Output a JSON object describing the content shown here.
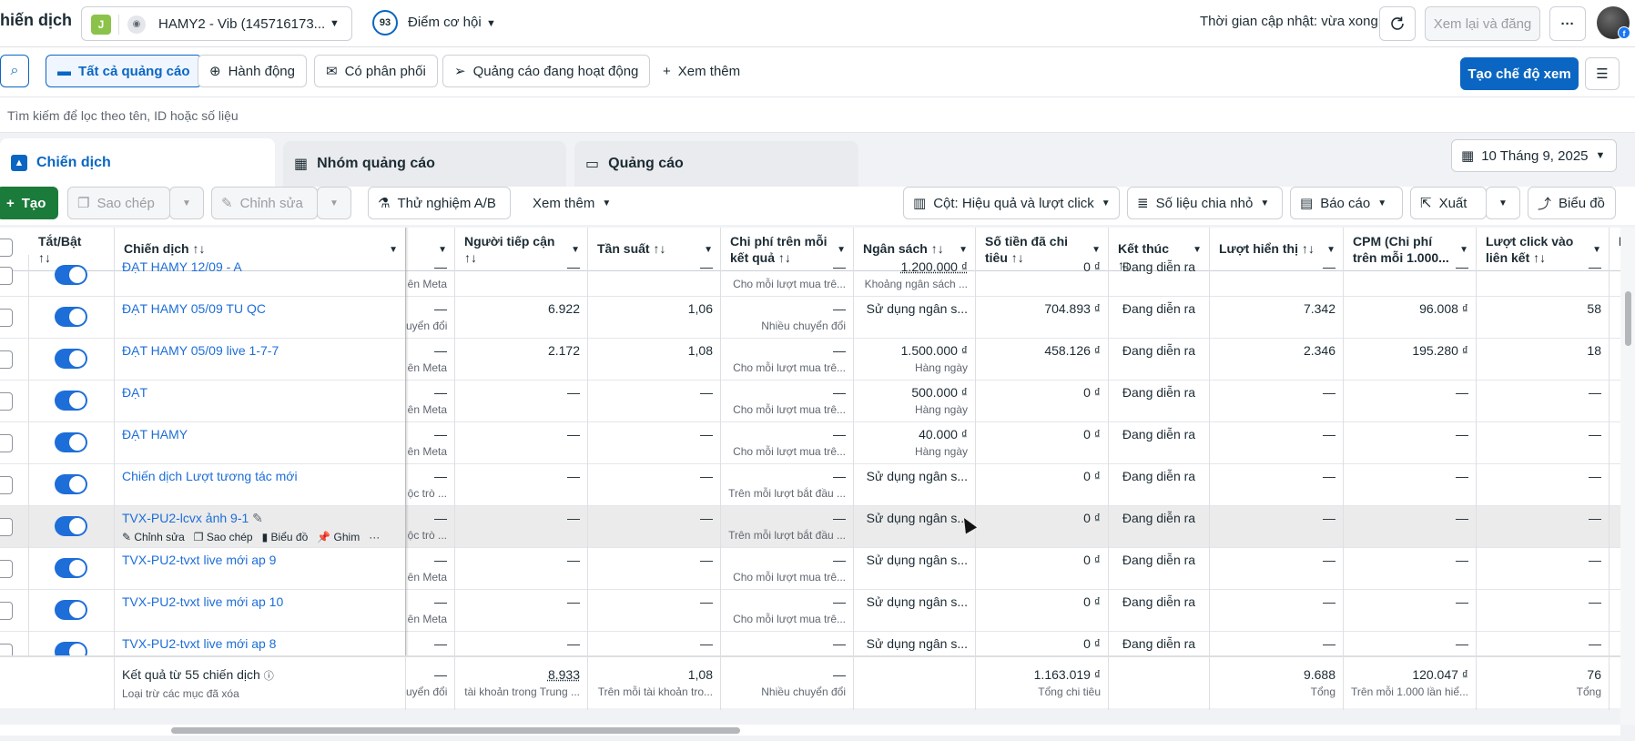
{
  "header": {
    "app_title": "hiến dịch",
    "account_badge": "J",
    "account_name": "HAMY2 - Vib (145716173...",
    "opportunity_score": "93",
    "opportunity_label": "Điểm cơ hội",
    "updated_text": "Thời gian cập nhật: vừa xong",
    "review_publish": "Xem lại và đăng",
    "more": "···"
  },
  "filters": {
    "all_ads": "Tất cả quảng cáo",
    "actions": "Hành động",
    "delivery": "Có phân phối",
    "active_ads": "Quảng cáo đang hoạt động",
    "see_more": "Xem thêm",
    "create_view": "Tạo chế độ xem",
    "search_placeholder": "Tìm kiếm để lọc theo tên, ID hoặc số liệu"
  },
  "tabs": {
    "campaigns": "Chiến dịch",
    "ad_sets": "Nhóm quảng cáo",
    "ads": "Quảng cáo",
    "date": "10 Tháng 9, 2025"
  },
  "toolbar": {
    "create": "Tạo",
    "duplicate": "Sao chép",
    "edit": "Chỉnh sửa",
    "ab_test": "Thử nghiệm A/B",
    "more": "Xem thêm",
    "columns": "Cột: Hiệu quả và lượt click",
    "breakdown": "Số liệu chia nhỏ",
    "reports": "Báo cáo",
    "export": "Xuất",
    "charts": "Biểu đồ"
  },
  "columns": {
    "toggle": "Tắt/Bật ↑↓",
    "campaign": "Chiến dịch ↑↓",
    "reach": "Người tiếp cận ↑↓",
    "frequency": "Tần suất ↑↓",
    "cost_per_result": "Chi phí trên mỗi kết quả ↑↓",
    "budget": "Ngân sách ↑↓",
    "amount_spent": "Số tiền đã chi tiêu ↑↓",
    "ends": "Kết thúc ↑↓",
    "impressions": "Lượt hiển thị ↑↓",
    "cpm": "CPM (Chi phí trên mỗi 1.000...",
    "link_clicks": "Lượt click vào liên kết ↑↓",
    "last": "L v"
  },
  "rows": [
    {
      "name": "ĐẠT HAMY 12/09 - A",
      "res_sub": "ên Meta",
      "reach": "—",
      "freq": "—",
      "cpr": "—",
      "cpr_sub": "Cho mỗi lượt mua trê...",
      "budget": "1.200.000 ₫",
      "budget_sub": "Khoảng ngân sách ...",
      "spent": "0 ₫",
      "ends": "Đang diễn ra",
      "impr": "—",
      "cpm": "—",
      "clicks": "—"
    },
    {
      "name": "ĐẠT HAMY 05/09 TU QC",
      "res_sub": "uyển đổi",
      "reach": "6.922",
      "freq": "1,06",
      "cpr": "—",
      "cpr_sub": "Nhiều chuyển đổi",
      "budget": "Sử dụng ngân s...",
      "budget_sub": "",
      "spent": "704.893 ₫",
      "ends": "Đang diễn ra",
      "impr": "7.342",
      "cpm": "96.008 ₫",
      "clicks": "58"
    },
    {
      "name": "ĐẠT HAMY 05/09 live 1-7-7",
      "res_sub": "ên Meta",
      "reach": "2.172",
      "freq": "1,08",
      "cpr": "—",
      "cpr_sub": "Cho mỗi lượt mua trê...",
      "budget": "1.500.000 ₫",
      "budget_sub": "Hàng ngày",
      "spent": "458.126 ₫",
      "ends": "Đang diễn ra",
      "impr": "2.346",
      "cpm": "195.280 ₫",
      "clicks": "18"
    },
    {
      "name": "ĐẠT",
      "res_sub": "ên Meta",
      "reach": "—",
      "freq": "—",
      "cpr": "—",
      "cpr_sub": "Cho mỗi lượt mua trê...",
      "budget": "500.000 ₫",
      "budget_sub": "Hàng ngày",
      "spent": "0 ₫",
      "ends": "Đang diễn ra",
      "impr": "—",
      "cpm": "—",
      "clicks": "—"
    },
    {
      "name": "ĐẠT HAMY",
      "res_sub": "ên Meta",
      "reach": "—",
      "freq": "—",
      "cpr": "—",
      "cpr_sub": "Cho mỗi lượt mua trê...",
      "budget": "40.000 ₫",
      "budget_sub": "Hàng ngày",
      "spent": "0 ₫",
      "ends": "Đang diễn ra",
      "impr": "—",
      "cpm": "—",
      "clicks": "—"
    },
    {
      "name": "Chiến dịch Lượt tương tác mới",
      "res_sub": "ộc trò ...",
      "reach": "—",
      "freq": "—",
      "cpr": "—",
      "cpr_sub": "Trên mỗi lượt bắt đầu ...",
      "budget": "Sử dụng ngân s...",
      "budget_sub": "",
      "spent": "0 ₫",
      "ends": "Đang diễn ra",
      "impr": "—",
      "cpm": "—",
      "clicks": "—"
    },
    {
      "name": "TVX-PU2-lcvx ảnh 9-1",
      "res_sub": "ộc trò ...",
      "reach": "—",
      "freq": "—",
      "cpr": "—",
      "cpr_sub": "Trên mỗi lượt bắt đầu ...",
      "budget": "Sử dụng ngân s...",
      "budget_sub": "",
      "spent": "0 ₫",
      "ends": "Đang diễn ra",
      "impr": "—",
      "cpm": "—",
      "clicks": "—"
    },
    {
      "name": "TVX-PU2-tvxt live mới ap 9",
      "res_sub": "ên Meta",
      "reach": "—",
      "freq": "—",
      "cpr": "—",
      "cpr_sub": "Cho mỗi lượt mua trê...",
      "budget": "Sử dụng ngân s...",
      "budget_sub": "",
      "spent": "0 ₫",
      "ends": "Đang diễn ra",
      "impr": "—",
      "cpm": "—",
      "clicks": "—"
    },
    {
      "name": "TVX-PU2-tvxt live mới ap 10",
      "res_sub": "ên Meta",
      "reach": "—",
      "freq": "—",
      "cpr": "—",
      "cpr_sub": "Cho mỗi lượt mua trê...",
      "budget": "Sử dụng ngân s...",
      "budget_sub": "",
      "spent": "0 ₫",
      "ends": "Đang diễn ra",
      "impr": "—",
      "cpm": "—",
      "clicks": "—"
    },
    {
      "name": "TVX-PU2-tvxt live mới ap 8",
      "res_sub": "",
      "reach": "—",
      "freq": "—",
      "cpr": "—",
      "cpr_sub": "",
      "budget": "Sử dụng ngân s...",
      "budget_sub": "",
      "spent": "0 ₫",
      "ends": "Đang diễn ra",
      "impr": "—",
      "cpm": "—",
      "clicks": "—"
    }
  ],
  "row_actions": {
    "edit": "Chỉnh sửa",
    "duplicate": "Sao chép",
    "chart": "Biểu đồ",
    "pin": "Ghim",
    "more": "···"
  },
  "totals": {
    "label": "Kết quả từ 55 chiến dịch",
    "label_sub": "Loại trừ các mục đã xóa",
    "res": "—",
    "res_sub": "uyển đổi",
    "reach": "8.933",
    "reach_sub": "tài khoản trong Trung ...",
    "freq": "1,08",
    "freq_sub": "Trên mỗi tài khoản tro...",
    "cpr": "—",
    "cpr_sub": "Nhiều chuyển đổi",
    "spent": "1.163.019 ₫",
    "spent_sub": "Tổng chi tiêu",
    "impr": "9.688",
    "impr_sub": "Tổng",
    "cpm": "120.047 ₫",
    "cpm_sub": "Trên mỗi 1.000 lần hiể...",
    "clicks": "76",
    "clicks_sub": "Tổng"
  },
  "colors": {
    "accent": "#0a66c2",
    "link": "#1d6ed8",
    "create_green": "#1b7b3a"
  }
}
